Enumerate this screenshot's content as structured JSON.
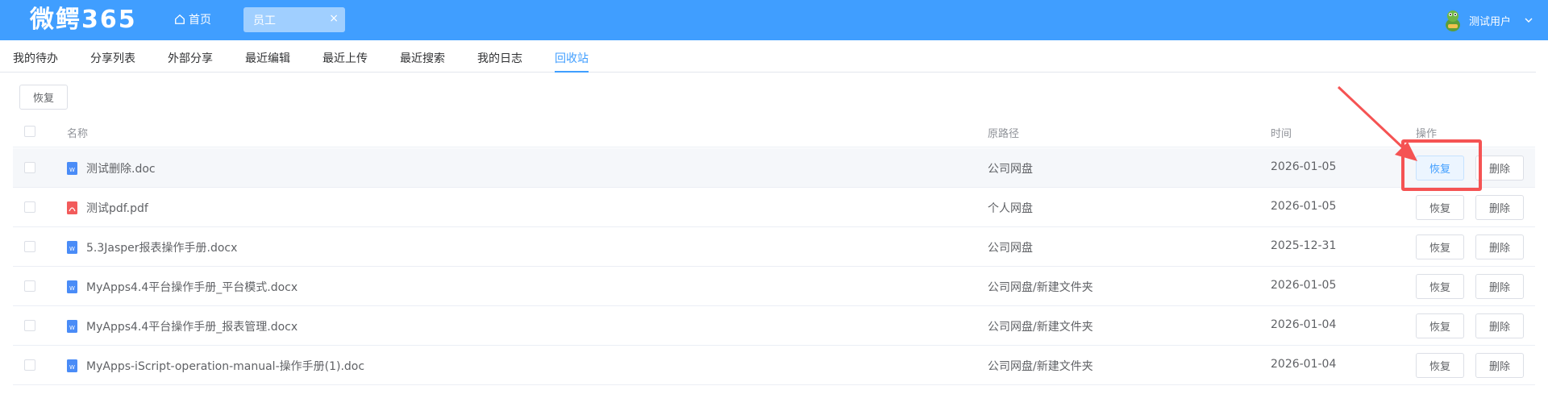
{
  "header": {
    "logo": "微鳄365",
    "home_label": "首页",
    "open_tab": "员工",
    "close_symbol": "×",
    "user_name": "测试用户",
    "bg_color": "#409eff"
  },
  "nav": {
    "items": [
      {
        "label": "我的待办"
      },
      {
        "label": "分享列表"
      },
      {
        "label": "外部分享"
      },
      {
        "label": "最近编辑"
      },
      {
        "label": "最近上传"
      },
      {
        "label": "最近搜索"
      },
      {
        "label": "我的日志"
      },
      {
        "label": "回收站",
        "active": true
      }
    ],
    "active_color": "#409eff"
  },
  "toolbar": {
    "restore_label": "恢复"
  },
  "table": {
    "columns": [
      "名称",
      "原路径",
      "时间",
      "操作"
    ],
    "rows": [
      {
        "name": "测试删除.doc",
        "type": "word-icon",
        "path": "公司网盘",
        "time": "2026-01-05",
        "restore": "恢复",
        "delete": "删除"
      },
      {
        "name": "测试pdf.pdf",
        "type": "pdf-icon",
        "path": "个人网盘",
        "time": "2026-01-05",
        "restore": "恢复",
        "delete": "删除"
      },
      {
        "name": "5.3Jasper报表操作手册.docx",
        "type": "word-icon",
        "path": "公司网盘",
        "time": "2025-12-31",
        "restore": "恢复",
        "delete": "删除"
      },
      {
        "name": "MyApps4.4平台操作手册_平台模式.docx",
        "type": "word-icon",
        "path": "公司网盘/新建文件夹",
        "time": "2026-01-05",
        "restore": "恢复",
        "delete": "删除"
      },
      {
        "name": "MyApps4.4平台操作手册_报表管理.docx",
        "type": "word-icon",
        "path": "公司网盘/新建文件夹",
        "time": "2026-01-04",
        "restore": "恢复",
        "delete": "删除"
      },
      {
        "name": "MyApps-iScript-operation-manual-操作手册(1).doc",
        "type": "word-icon",
        "path": "公司网盘/新建文件夹",
        "time": "2026-01-04",
        "restore": "恢复",
        "delete": "删除"
      }
    ]
  },
  "colors": {
    "word": "#4a8cf7",
    "pdf": "#f25b5b",
    "annotation": "#f55353"
  }
}
